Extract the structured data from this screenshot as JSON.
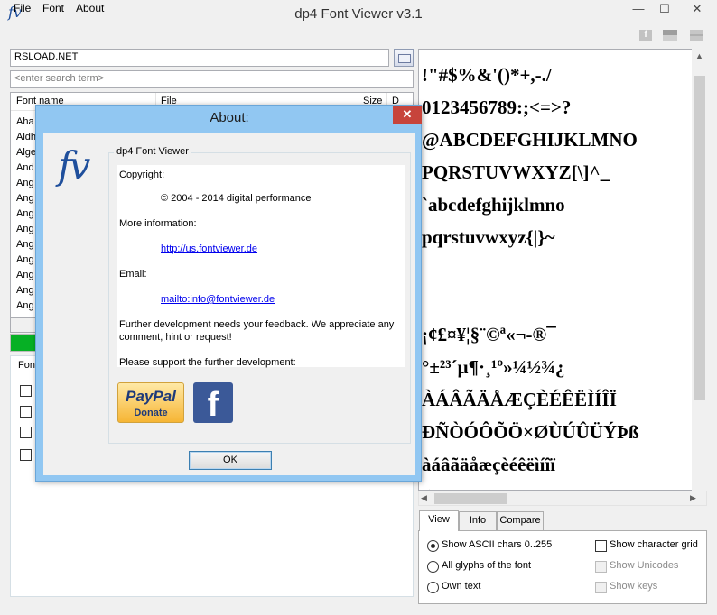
{
  "window": {
    "title": "dp4 Font Viewer v3.1",
    "logo_text": "fv",
    "minimize": "—",
    "maximize": "☐",
    "close": "✕"
  },
  "menu": {
    "file": "File",
    "font": "Font",
    "about": "About"
  },
  "toolbar_icons": [
    "facebook-icon",
    "bars-icon",
    "flag-icon"
  ],
  "url_field": {
    "value": "RSLOAD.NET"
  },
  "search": {
    "placeholder": "<enter search term>"
  },
  "font_list": {
    "columns": [
      "Font name",
      "File",
      "Size",
      "D"
    ],
    "rows": [
      "Aha",
      "Aldh",
      "Alge",
      "And",
      "Ang",
      "Ang",
      "Ang",
      "Ang",
      "Ang",
      "Ang",
      "Ang",
      "Ang",
      "Ang",
      "Apa"
    ]
  },
  "progress": {
    "fraction": 0.06,
    "color": "#06b025"
  },
  "options_group": {
    "title": "Fon"
  },
  "preview": {
    "lines": [
      "!\"#$%&'()*+,-./",
      "0123456789:;<=>?",
      "@ABCDEFGHIJKLMNO",
      "PQRSTUVWXYZ[\\]^_",
      "`abcdefghijklmno",
      "pqrstuvwxyz{|}~",
      "",
      "",
      " ¡¢£¤¥¦§¨©ª«¬-®¯",
      "°±²³´µ¶·¸¹º»¼½¾¿",
      "ÀÁÂÃÄÅÆÇÈÉÊËÌÍÎÏ",
      "ÐÑÒÓÔÕÖ×ØÙÚÛÜÝÞß",
      "àáâãäåæçèéêëìíîï",
      "ðñòóôõö÷øùúûüýþÿ"
    ]
  },
  "tabs": {
    "view": "View",
    "info": "Info",
    "compare": "Compare"
  },
  "view_options": {
    "radio_ascii": "Show ASCII chars 0..255",
    "radio_all": "All glyphs of the font",
    "radio_own": "Own text",
    "check_grid": "Show character grid",
    "check_unicodes": "Show Unicodes",
    "check_keys": "Show keys"
  },
  "about": {
    "title": "About:",
    "close": "✕",
    "logo_text": "fv",
    "group_title": "dp4 Font Viewer",
    "copyright_label": "Copyright:",
    "copyright_value": "© 2004 - 2014 digital performance",
    "more_info_label": "More information:",
    "more_info_link": "http://us.fontviewer.de",
    "email_label": "Email:",
    "email_link": "mailto:info@fontviewer.de",
    "feedback_text": "Further development needs your feedback. We appreciate any comment, hint or request!",
    "support_text": "Please support the further development:",
    "paypal_label": "PayPal",
    "paypal_donate": "Donate",
    "facebook_label": "f",
    "ok_label": "OK"
  }
}
